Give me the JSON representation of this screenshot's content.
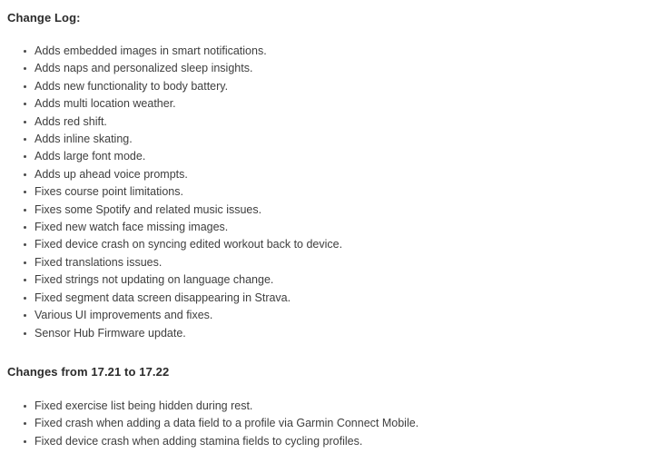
{
  "document": {
    "sections": [
      {
        "heading": "Change Log:",
        "items": [
          "Adds embedded images in smart notifications.",
          "Adds naps and personalized sleep insights.",
          "Adds new functionality to body battery.",
          "Adds multi location weather.",
          "Adds red shift.",
          "Adds inline skating.",
          "Adds large font mode.",
          "Adds up ahead voice prompts.",
          "Fixes course point limitations.",
          "Fixes some Spotify and related music issues.",
          "Fixed new watch face missing images.",
          "Fixed device crash on syncing edited workout back to device.",
          "Fixed translations issues.",
          "Fixed strings not updating on language change.",
          "Fixed segment data screen disappearing in Strava.",
          "Various UI improvements and fixes.",
          "Sensor Hub Firmware update."
        ]
      },
      {
        "heading": "Changes from 17.21 to 17.22",
        "items": [
          "Fixed exercise list being hidden during rest.",
          "Fixed crash when adding a data field to a profile via Garmin Connect Mobile.",
          "Fixed device crash when adding stamina fields to cycling profiles."
        ]
      }
    ]
  },
  "colors": {
    "background": "#ffffff",
    "heading_text": "#2b2b2b",
    "body_text": "#3e3e3e",
    "bullet": "#4a4a4a"
  }
}
